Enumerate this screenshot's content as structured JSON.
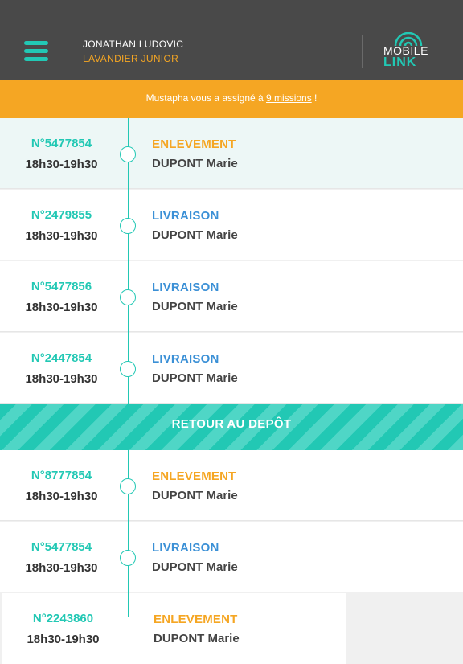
{
  "header": {
    "user_name": "JONATHAN LUDOVIC",
    "user_role": "LAVANDIER JUNIOR",
    "logo_top": "MOBILE",
    "logo_bottom": "LINK",
    "menu_icon": "hamburger-menu-icon"
  },
  "notice": {
    "prefix": "Mustapha vous a assigné à ",
    "link": "9 missions",
    "suffix": " !"
  },
  "missions": [
    {
      "number": "N°5477854",
      "time": "18h30-19h30",
      "type": "ENLEVEMENT",
      "client": "DUPONT Marie"
    },
    {
      "number": "N°2479855",
      "time": "18h30-19h30",
      "type": "LIVRAISON",
      "client": "DUPONT Marie"
    },
    {
      "number": "N°5477856",
      "time": "18h30-19h30",
      "type": "LIVRAISON",
      "client": "DUPONT Marie"
    },
    {
      "number": "N°2447854",
      "time": "18h30-19h30",
      "type": "LIVRAISON",
      "client": "DUPONT Marie"
    },
    {
      "number": "N°8777854",
      "time": "18h30-19h30",
      "type": "ENLEVEMENT",
      "client": "DUPONT Marie"
    },
    {
      "number": "N°5477854",
      "time": "18h30-19h30",
      "type": "LIVRAISON",
      "client": "DUPONT Marie"
    },
    {
      "number": "N°2243860",
      "time": "18h30-19h30",
      "type": "ENLEVEMENT",
      "client": "DUPONT Marie"
    }
  ],
  "depot_label": "RETOUR AU DEPÔT",
  "colors": {
    "accent_teal": "#22c8b4",
    "accent_orange": "#f5a623",
    "delivery_blue": "#3b90d6",
    "header_bg": "#494949"
  }
}
